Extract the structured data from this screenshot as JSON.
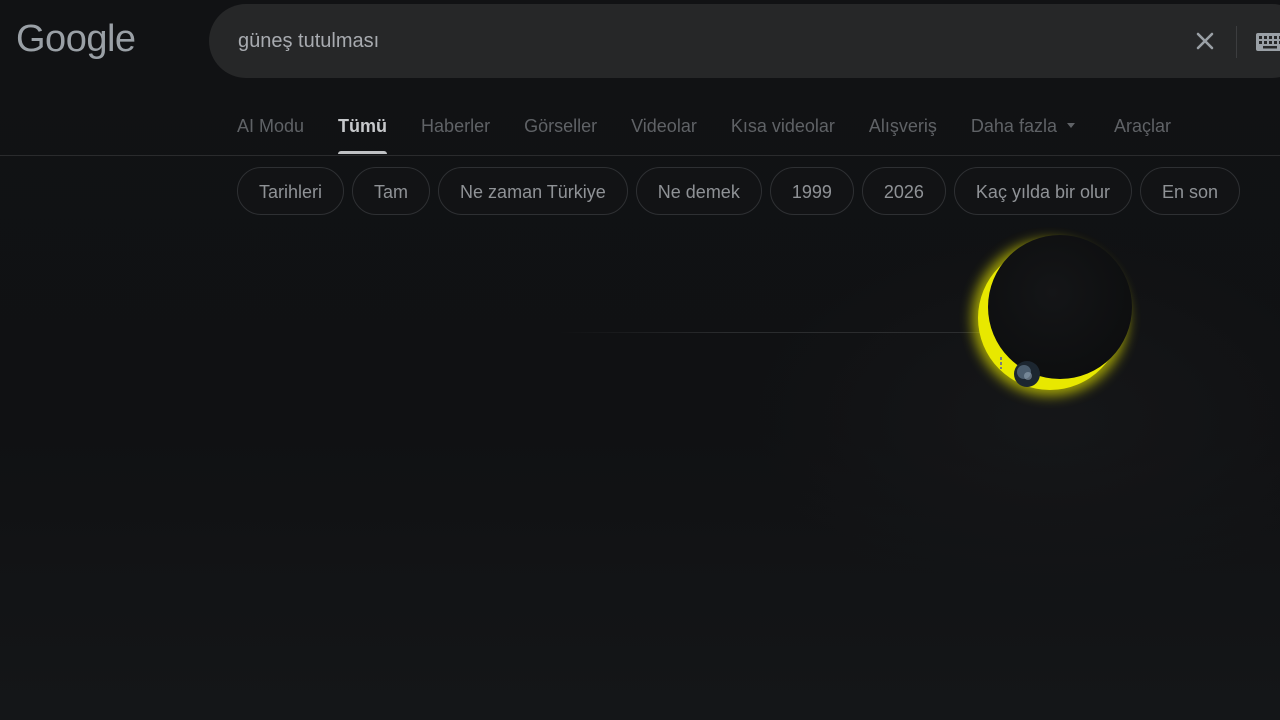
{
  "logo": {
    "text": "Google"
  },
  "search": {
    "query": "güneş tutulması"
  },
  "tabs": [
    {
      "label": "AI Modu"
    },
    {
      "label": "Tümü"
    },
    {
      "label": "Haberler"
    },
    {
      "label": "Görseller"
    },
    {
      "label": "Videolar"
    },
    {
      "label": "Kısa videolar"
    },
    {
      "label": "Alışveriş"
    },
    {
      "label": "Daha fazla"
    },
    {
      "label": "Araçlar"
    }
  ],
  "chips": [
    {
      "label": "Tarihleri"
    },
    {
      "label": "Tam"
    },
    {
      "label": "Ne zaman Türkiye"
    },
    {
      "label": "Ne demek"
    },
    {
      "label": "1999"
    },
    {
      "label": "2026"
    },
    {
      "label": "Kaç yılda bir olur"
    },
    {
      "label": "En son"
    }
  ],
  "colors": {
    "background": "#101113",
    "searchbar": "#262728",
    "eclipse_corona": "#e6e600"
  }
}
